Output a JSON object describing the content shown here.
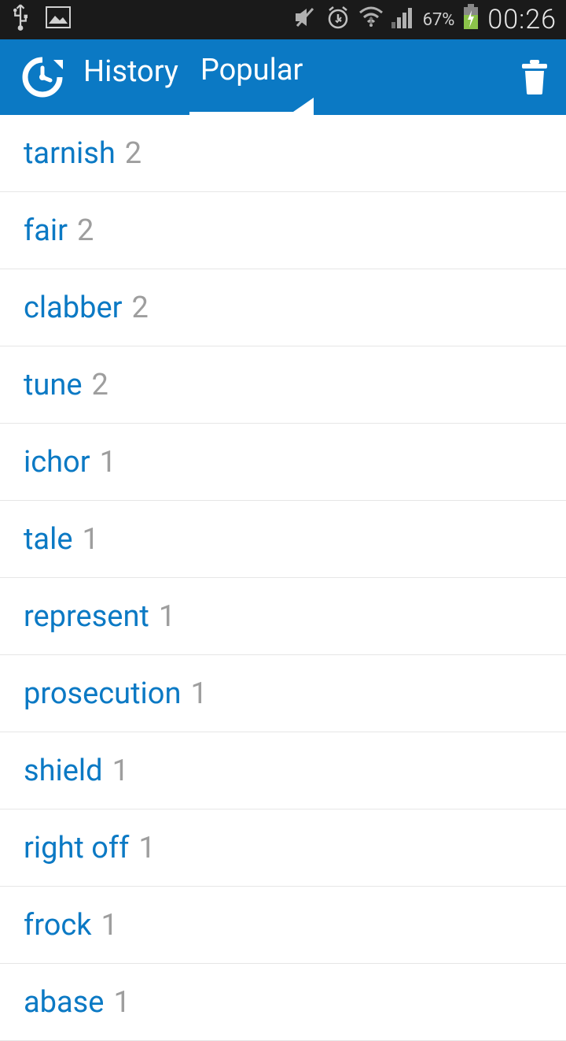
{
  "status": {
    "battery_pct": "67%",
    "time": "00:26"
  },
  "appbar": {
    "tabs": [
      {
        "label": "History",
        "active": false
      },
      {
        "label": "Popular",
        "active": true
      }
    ]
  },
  "list": {
    "items": [
      {
        "word": "tarnish",
        "count": "2"
      },
      {
        "word": "fair",
        "count": "2"
      },
      {
        "word": "clabber",
        "count": "2"
      },
      {
        "word": "tune",
        "count": "2"
      },
      {
        "word": "ichor",
        "count": "1"
      },
      {
        "word": "tale",
        "count": "1"
      },
      {
        "word": "represent",
        "count": "1"
      },
      {
        "word": "prosecution",
        "count": "1"
      },
      {
        "word": "shield",
        "count": "1"
      },
      {
        "word": "right off",
        "count": "1"
      },
      {
        "word": "frock",
        "count": "1"
      },
      {
        "word": "abase",
        "count": "1"
      }
    ]
  }
}
